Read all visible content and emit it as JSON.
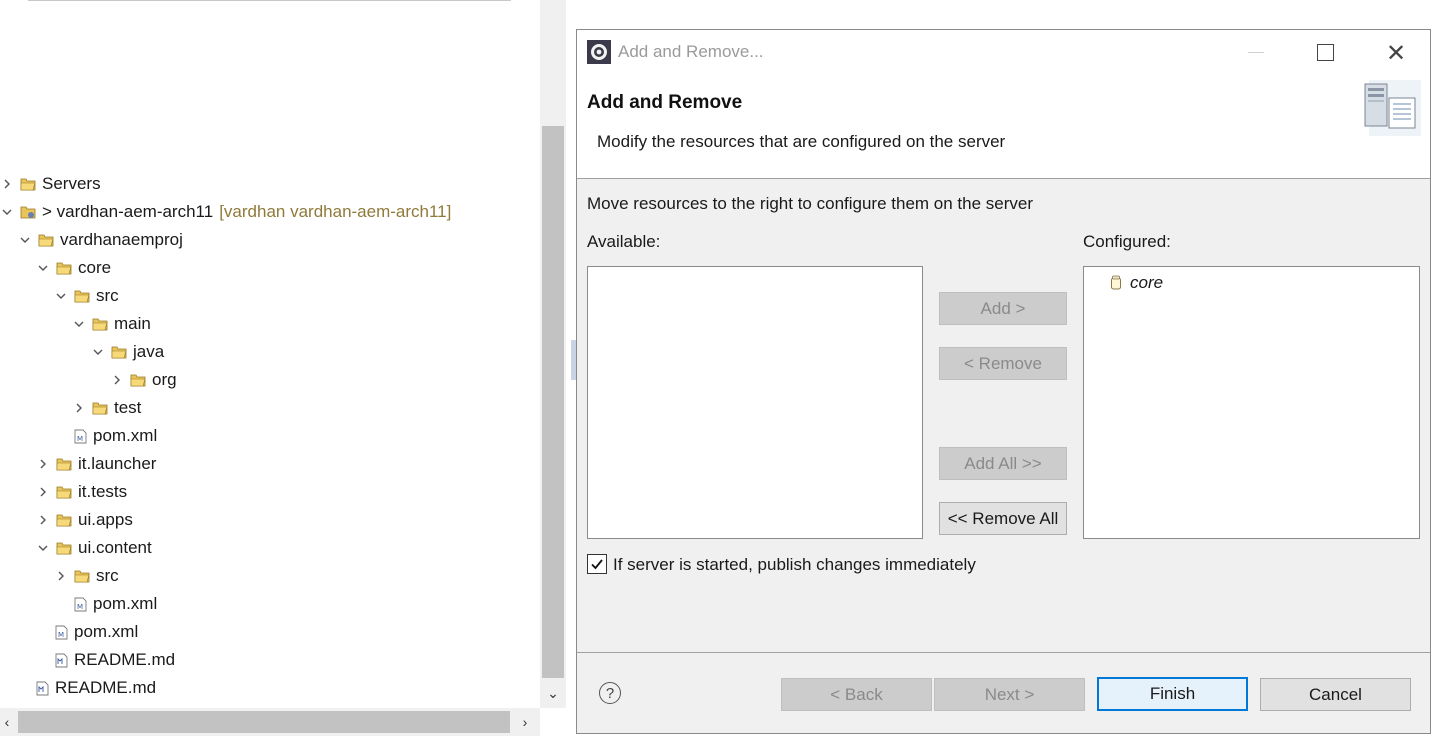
{
  "explorer": {
    "items": [
      {
        "label": "Servers",
        "decoration": ""
      },
      {
        "label": "> vardhan-aem-arch11",
        "decoration": "[vardhan vardhan-aem-arch11]"
      },
      {
        "label": "vardhanaemproj",
        "decoration": ""
      },
      {
        "label": "core",
        "decoration": ""
      },
      {
        "label": "src",
        "decoration": ""
      },
      {
        "label": "main",
        "decoration": ""
      },
      {
        "label": "java",
        "decoration": ""
      },
      {
        "label": "org",
        "decoration": ""
      },
      {
        "label": "test",
        "decoration": ""
      },
      {
        "label": "pom.xml",
        "decoration": ""
      },
      {
        "label": "it.launcher",
        "decoration": ""
      },
      {
        "label": "it.tests",
        "decoration": ""
      },
      {
        "label": "ui.apps",
        "decoration": ""
      },
      {
        "label": "ui.content",
        "decoration": ""
      },
      {
        "label": "src",
        "decoration": ""
      },
      {
        "label": "pom.xml",
        "decoration": ""
      },
      {
        "label": "pom.xml",
        "decoration": ""
      },
      {
        "label": "README.md",
        "decoration": ""
      },
      {
        "label": "README.md",
        "decoration": ""
      }
    ]
  },
  "dialog": {
    "window_title": "Add and Remove...",
    "header_title": "Add and Remove",
    "header_description": "Modify the resources that are configured on the server",
    "instructions": "Move resources to the right to configure them on the server",
    "available_label": "Available:",
    "configured_label": "Configured:",
    "available_items": [],
    "configured_items": [
      {
        "label": "core"
      }
    ],
    "buttons": {
      "add": "Add >",
      "remove": "< Remove",
      "add_all": "Add All >>",
      "remove_all": "<< Remove All",
      "back": "< Back",
      "next": "Next >",
      "finish": "Finish",
      "cancel": "Cancel"
    },
    "publish_checkbox": {
      "label": "If server is started, publish changes immediately",
      "checked": true
    },
    "help_glyph": "?"
  },
  "colors": {
    "accent": "#0078d7",
    "decoration_text": "#8f7a3a",
    "folder": "#e8b84a"
  }
}
